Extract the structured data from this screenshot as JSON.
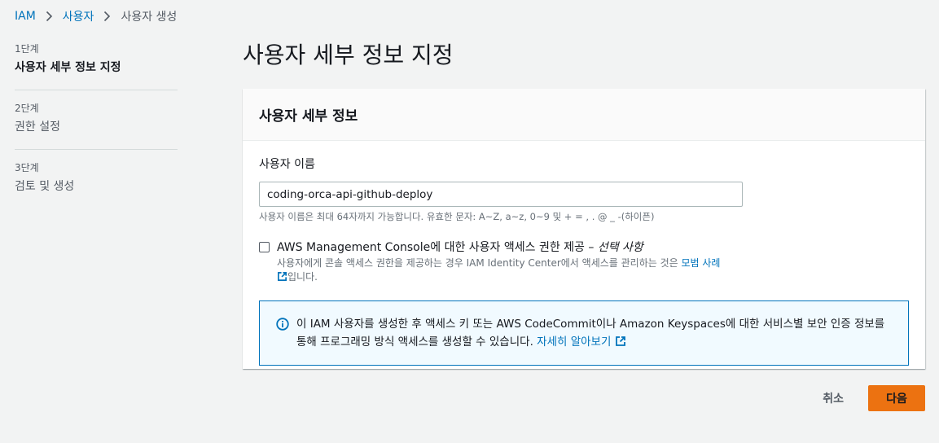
{
  "breadcrumb": {
    "items": [
      "IAM",
      "사용자",
      "사용자 생성"
    ]
  },
  "steps": [
    {
      "num": "1단계",
      "title": "사용자 세부 정보 지정"
    },
    {
      "num": "2단계",
      "title": "권한 설정"
    },
    {
      "num": "3단계",
      "title": "검토 및 생성"
    }
  ],
  "page": {
    "title": "사용자 세부 정보 지정"
  },
  "panel": {
    "title": "사용자 세부 정보",
    "username_label": "사용자 이름",
    "username_value": "coding-orca-api-github-deploy",
    "username_hint": "사용자 이름은 최대 64자까지 가능합니다. 유효한 문자: A~Z, a~z, 0~9 및 + = , . @ _ -(하이픈)",
    "console_access": {
      "label": "AWS Management Console에 대한 사용자 액세스 권한 제공 – ",
      "optional": "선택 사항",
      "desc": "사용자에게 콘솔 액세스 권한을 제공하는 경우 IAM Identity Center에서 액세스를 관리하는 것은 ",
      "desc_link": "모범 사례",
      "desc_suffix": "입니다."
    },
    "info": {
      "text": "이 IAM 사용자를 생성한 후 액세스 키 또는 AWS CodeCommit이나 Amazon Keyspaces에 대한 서비스별 보안 인증 정보를 통해 프로그래밍 방식 액세스를 생성할 수 있습니다. ",
      "link": "자세히 알아보기"
    }
  },
  "actions": {
    "cancel": "취소",
    "next": "다음"
  },
  "colors": {
    "link": "#0073bb",
    "primary_button": "#ec7211",
    "info_border": "#0073bb",
    "info_bg": "#f1faff"
  }
}
